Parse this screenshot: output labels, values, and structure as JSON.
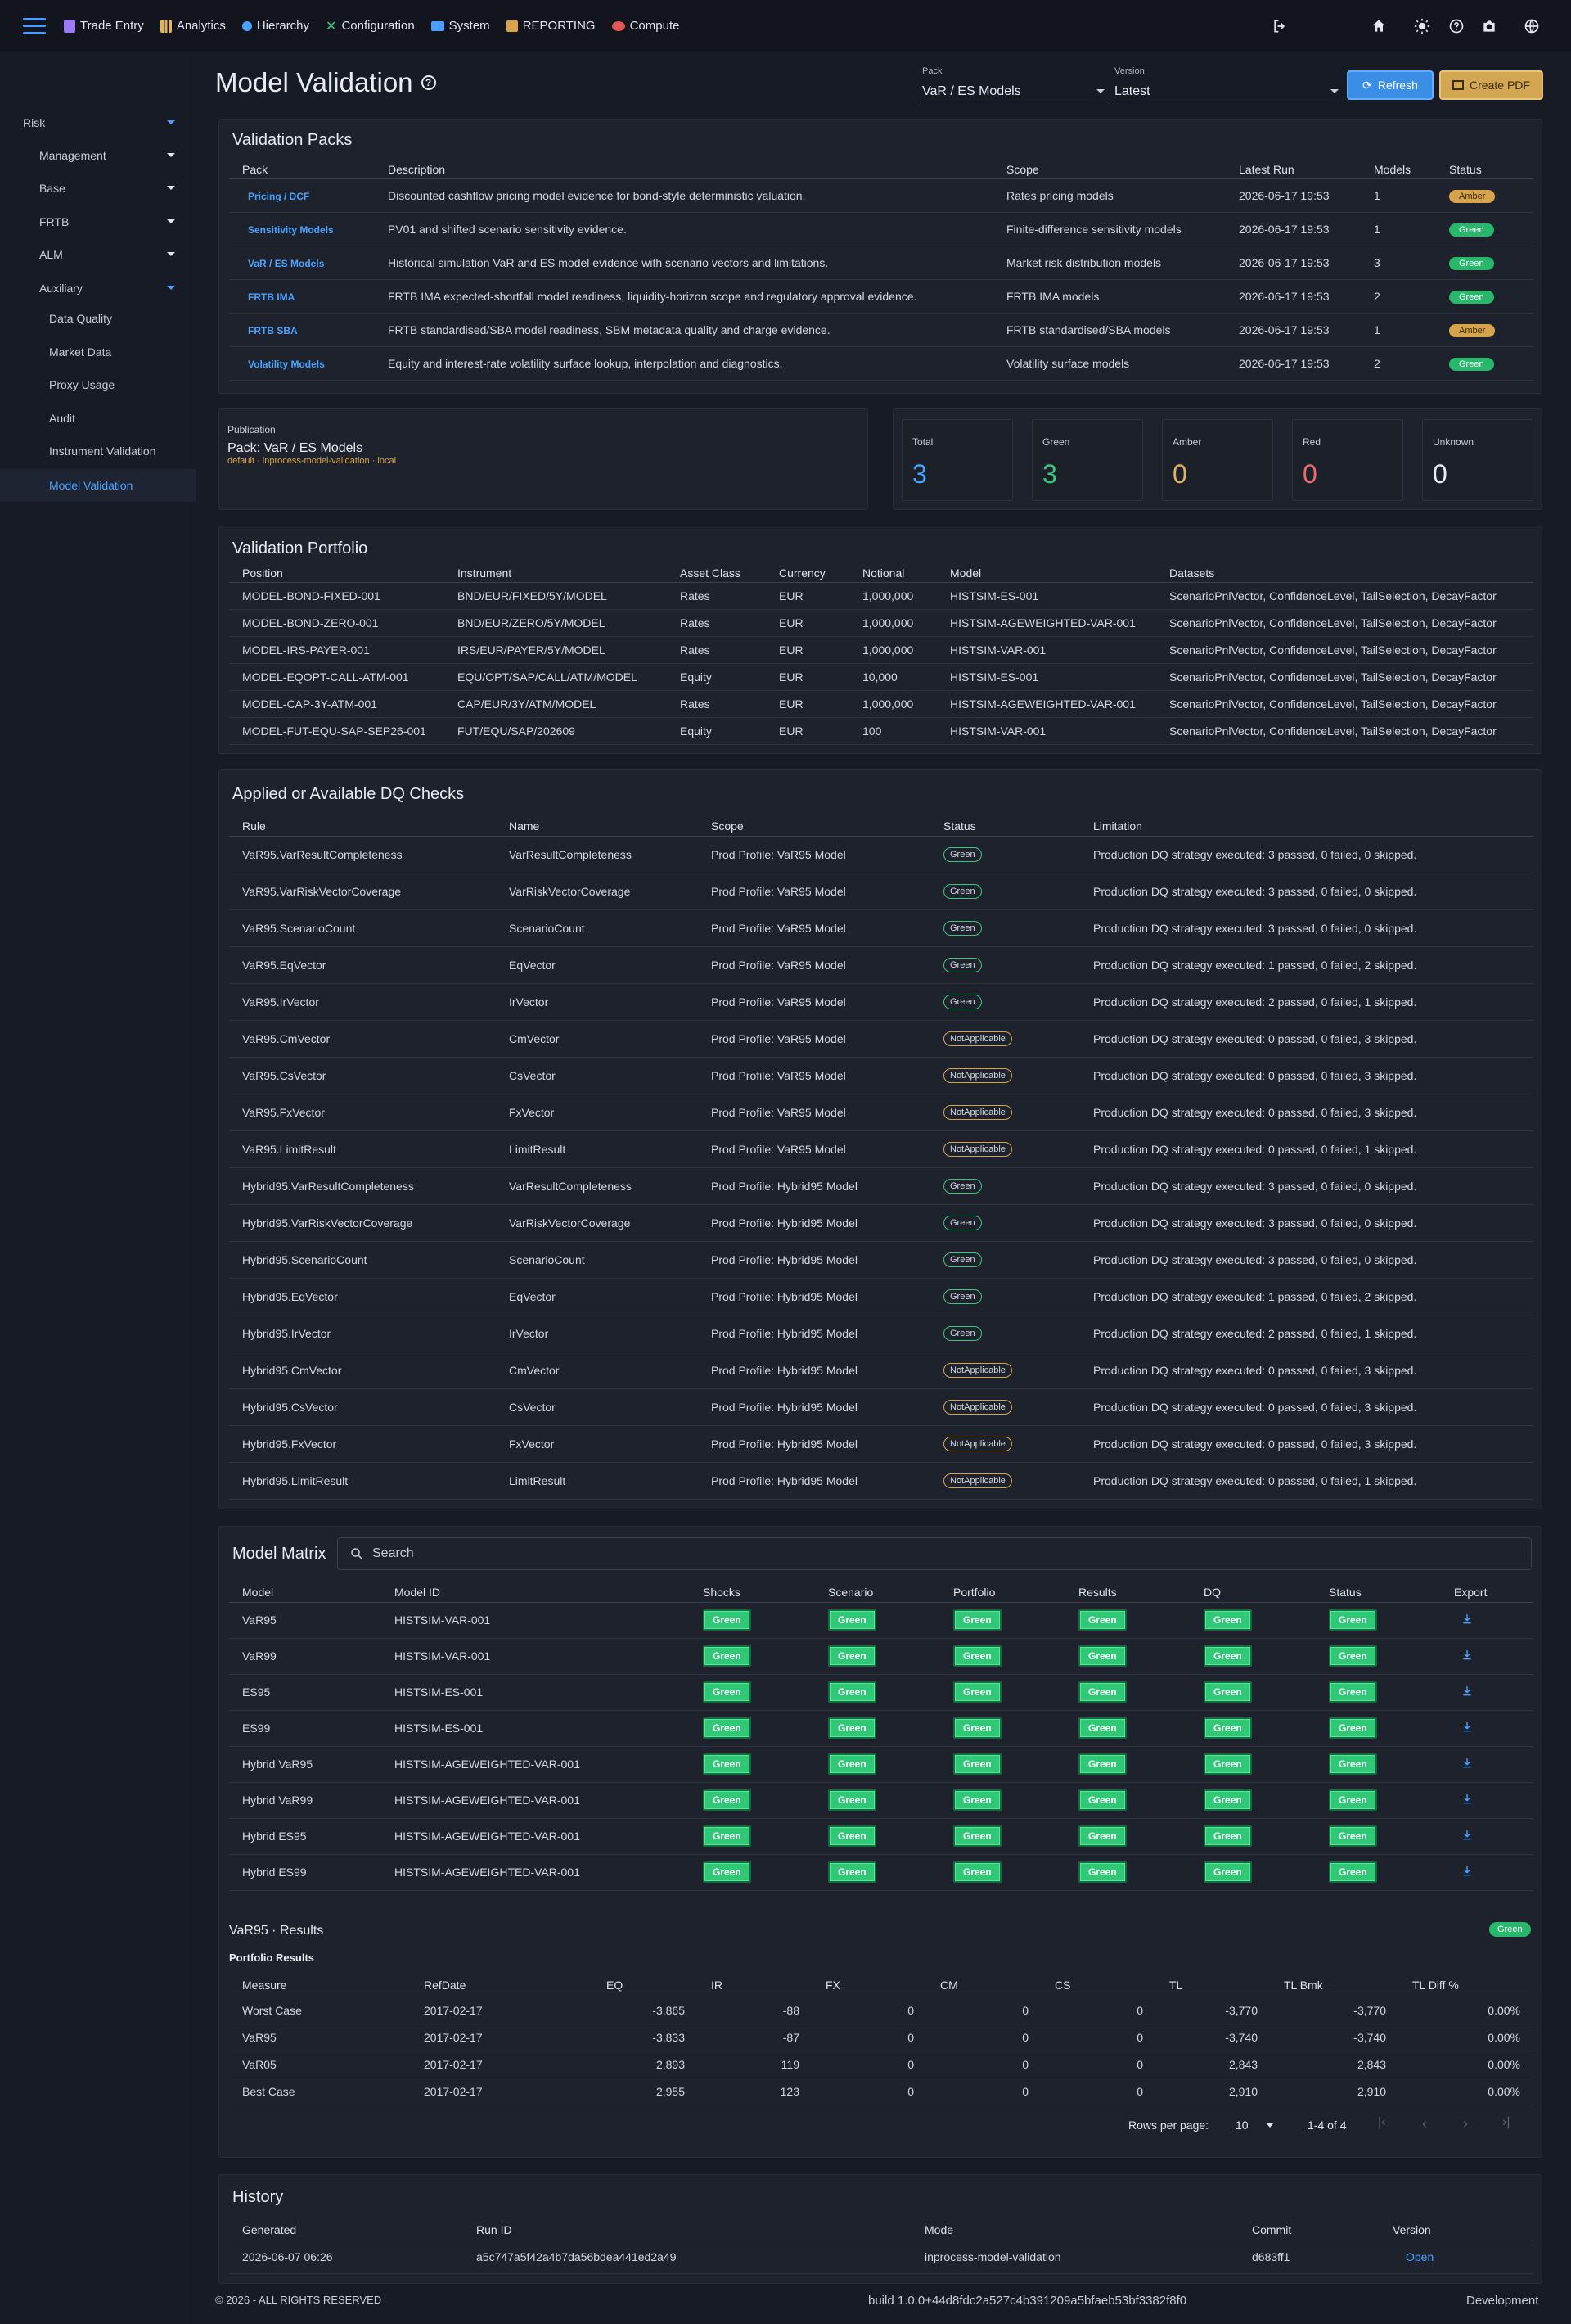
{
  "topnav": [
    "Trade Entry",
    "Analytics",
    "Hierarchy",
    "Configuration",
    "System",
    "REPORTING",
    "Compute"
  ],
  "sidebar": {
    "items": [
      "Risk",
      "Management",
      "Base",
      "FRTB",
      "ALM",
      "Auxiliary"
    ],
    "subitems": [
      "Data Quality",
      "Market Data",
      "Proxy Usage",
      "Audit",
      "Instrument Validation",
      "Model Validation"
    ]
  },
  "page": {
    "title": "Model Validation"
  },
  "controls": {
    "pack_label": "Pack",
    "pack_value": "VaR / ES Models",
    "version_label": "Version",
    "version_value": "Latest",
    "refresh": "Refresh",
    "create_pdf": "Create PDF"
  },
  "packs": {
    "title": "Validation Packs",
    "headers": [
      "Pack",
      "Description",
      "Scope",
      "Latest Run",
      "Models",
      "Status"
    ],
    "rows": [
      [
        "Pricing / DCF",
        "Discounted cashflow pricing model evidence for bond-style deterministic valuation.",
        "Rates pricing models",
        "2026-06-17 19:53",
        "1",
        "Amber"
      ],
      [
        "Sensitivity Models",
        "PV01 and shifted scenario sensitivity evidence.",
        "Finite-difference sensitivity models",
        "2026-06-17 19:53",
        "1",
        "Green"
      ],
      [
        "VaR / ES Models",
        "Historical simulation VaR and ES model evidence with scenario vectors and limitations.",
        "Market risk distribution models",
        "2026-06-17 19:53",
        "3",
        "Green"
      ],
      [
        "FRTB IMA",
        "FRTB IMA expected-shortfall model readiness, liquidity-horizon scope and regulatory approval evidence.",
        "FRTB IMA models",
        "2026-06-17 19:53",
        "2",
        "Green"
      ],
      [
        "FRTB SBA",
        "FRTB standardised/SBA model readiness, SBM metadata quality and charge evidence.",
        "FRTB standardised/SBA models",
        "2026-06-17 19:53",
        "1",
        "Amber"
      ],
      [
        "Volatility Models",
        "Equity and interest-rate volatility surface lookup, interpolation and diagnostics.",
        "Volatility surface models",
        "2026-06-17 19:53",
        "2",
        "Green"
      ]
    ]
  },
  "publication": {
    "label": "Publication",
    "pack": "Pack: VaR / ES Models",
    "meta": "default · inprocess-model-validation · local"
  },
  "stats": [
    {
      "label": "Total",
      "value": "3",
      "color": "#4aa3ff"
    },
    {
      "label": "Green",
      "value": "3",
      "color": "#3cc77c"
    },
    {
      "label": "Amber",
      "value": "0",
      "color": "#e0b259"
    },
    {
      "label": "Red",
      "value": "0",
      "color": "#f06a6a"
    },
    {
      "label": "Unknown",
      "value": "0",
      "color": "#e8ebf0"
    }
  ],
  "portfolio": {
    "title": "Validation Portfolio",
    "headers": [
      "Position",
      "Instrument",
      "Asset Class",
      "Currency",
      "Notional",
      "Model",
      "Datasets"
    ],
    "rows": [
      [
        "MODEL-BOND-FIXED-001",
        "BND/EUR/FIXED/5Y/MODEL",
        "Rates",
        "EUR",
        "1,000,000",
        "HISTSIM-ES-001",
        "ScenarioPnlVector, ConfidenceLevel, TailSelection, DecayFactor"
      ],
      [
        "MODEL-BOND-ZERO-001",
        "BND/EUR/ZERO/5Y/MODEL",
        "Rates",
        "EUR",
        "1,000,000",
        "HISTSIM-AGEWEIGHTED-VAR-001",
        "ScenarioPnlVector, ConfidenceLevel, TailSelection, DecayFactor"
      ],
      [
        "MODEL-IRS-PAYER-001",
        "IRS/EUR/PAYER/5Y/MODEL",
        "Rates",
        "EUR",
        "1,000,000",
        "HISTSIM-VAR-001",
        "ScenarioPnlVector, ConfidenceLevel, TailSelection, DecayFactor"
      ],
      [
        "MODEL-EQOPT-CALL-ATM-001",
        "EQU/OPT/SAP/CALL/ATM/MODEL",
        "Equity",
        "EUR",
        "10,000",
        "HISTSIM-ES-001",
        "ScenarioPnlVector, ConfidenceLevel, TailSelection, DecayFactor"
      ],
      [
        "MODEL-CAP-3Y-ATM-001",
        "CAP/EUR/3Y/ATM/MODEL",
        "Rates",
        "EUR",
        "1,000,000",
        "HISTSIM-AGEWEIGHTED-VAR-001",
        "ScenarioPnlVector, ConfidenceLevel, TailSelection, DecayFactor"
      ],
      [
        "MODEL-FUT-EQU-SAP-SEP26-001",
        "FUT/EQU/SAP/202609",
        "Equity",
        "EUR",
        "100",
        "HISTSIM-VAR-001",
        "ScenarioPnlVector, ConfidenceLevel, TailSelection, DecayFactor"
      ]
    ]
  },
  "dq": {
    "title": "Applied or Available DQ Checks",
    "headers": [
      "Rule",
      "Name",
      "Scope",
      "Status",
      "Limitation"
    ],
    "rows": [
      [
        "VaR95.VarResultCompleteness",
        "VarResultCompleteness",
        "Prod Profile: VaR95 Model",
        "Green",
        "Production DQ strategy executed: 3 passed, 0 failed, 0 skipped."
      ],
      [
        "VaR95.VarRiskVectorCoverage",
        "VarRiskVectorCoverage",
        "Prod Profile: VaR95 Model",
        "Green",
        "Production DQ strategy executed: 3 passed, 0 failed, 0 skipped."
      ],
      [
        "VaR95.ScenarioCount",
        "ScenarioCount",
        "Prod Profile: VaR95 Model",
        "Green",
        "Production DQ strategy executed: 3 passed, 0 failed, 0 skipped."
      ],
      [
        "VaR95.EqVector",
        "EqVector",
        "Prod Profile: VaR95 Model",
        "Green",
        "Production DQ strategy executed: 1 passed, 0 failed, 2 skipped."
      ],
      [
        "VaR95.IrVector",
        "IrVector",
        "Prod Profile: VaR95 Model",
        "Green",
        "Production DQ strategy executed: 2 passed, 0 failed, 1 skipped."
      ],
      [
        "VaR95.CmVector",
        "CmVector",
        "Prod Profile: VaR95 Model",
        "NotApplicable",
        "Production DQ strategy executed: 0 passed, 0 failed, 3 skipped."
      ],
      [
        "VaR95.CsVector",
        "CsVector",
        "Prod Profile: VaR95 Model",
        "NotApplicable",
        "Production DQ strategy executed: 0 passed, 0 failed, 3 skipped."
      ],
      [
        "VaR95.FxVector",
        "FxVector",
        "Prod Profile: VaR95 Model",
        "NotApplicable",
        "Production DQ strategy executed: 0 passed, 0 failed, 3 skipped."
      ],
      [
        "VaR95.LimitResult",
        "LimitResult",
        "Prod Profile: VaR95 Model",
        "NotApplicable",
        "Production DQ strategy executed: 0 passed, 0 failed, 1 skipped."
      ],
      [
        "Hybrid95.VarResultCompleteness",
        "VarResultCompleteness",
        "Prod Profile: Hybrid95 Model",
        "Green",
        "Production DQ strategy executed: 3 passed, 0 failed, 0 skipped."
      ],
      [
        "Hybrid95.VarRiskVectorCoverage",
        "VarRiskVectorCoverage",
        "Prod Profile: Hybrid95 Model",
        "Green",
        "Production DQ strategy executed: 3 passed, 0 failed, 0 skipped."
      ],
      [
        "Hybrid95.ScenarioCount",
        "ScenarioCount",
        "Prod Profile: Hybrid95 Model",
        "Green",
        "Production DQ strategy executed: 3 passed, 0 failed, 0 skipped."
      ],
      [
        "Hybrid95.EqVector",
        "EqVector",
        "Prod Profile: Hybrid95 Model",
        "Green",
        "Production DQ strategy executed: 1 passed, 0 failed, 2 skipped."
      ],
      [
        "Hybrid95.IrVector",
        "IrVector",
        "Prod Profile: Hybrid95 Model",
        "Green",
        "Production DQ strategy executed: 2 passed, 0 failed, 1 skipped."
      ],
      [
        "Hybrid95.CmVector",
        "CmVector",
        "Prod Profile: Hybrid95 Model",
        "NotApplicable",
        "Production DQ strategy executed: 0 passed, 0 failed, 3 skipped."
      ],
      [
        "Hybrid95.CsVector",
        "CsVector",
        "Prod Profile: Hybrid95 Model",
        "NotApplicable",
        "Production DQ strategy executed: 0 passed, 0 failed, 3 skipped."
      ],
      [
        "Hybrid95.FxVector",
        "FxVector",
        "Prod Profile: Hybrid95 Model",
        "NotApplicable",
        "Production DQ strategy executed: 0 passed, 0 failed, 3 skipped."
      ],
      [
        "Hybrid95.LimitResult",
        "LimitResult",
        "Prod Profile: Hybrid95 Model",
        "NotApplicable",
        "Production DQ strategy executed: 0 passed, 0 failed, 1 skipped."
      ]
    ]
  },
  "matrix": {
    "title": "Model Matrix",
    "search_placeholder": "Search",
    "headers": [
      "Model",
      "Model ID",
      "Shocks",
      "Scenario",
      "Portfolio",
      "Results",
      "DQ",
      "Status",
      "Export"
    ],
    "rows": [
      [
        "VaR95",
        "HISTSIM-VAR-001"
      ],
      [
        "VaR99",
        "HISTSIM-VAR-001"
      ],
      [
        "ES95",
        "HISTSIM-ES-001"
      ],
      [
        "ES99",
        "HISTSIM-ES-001"
      ],
      [
        "Hybrid VaR95",
        "HISTSIM-AGEWEIGHTED-VAR-001"
      ],
      [
        "Hybrid VaR99",
        "HISTSIM-AGEWEIGHTED-VAR-001"
      ],
      [
        "Hybrid ES95",
        "HISTSIM-AGEWEIGHTED-VAR-001"
      ],
      [
        "Hybrid ES99",
        "HISTSIM-AGEWEIGHTED-VAR-001"
      ]
    ],
    "cell_value": "Green"
  },
  "results": {
    "title": "VaR95 · Results",
    "status": "Green",
    "subtitle": "Portfolio Results",
    "headers": [
      "Measure",
      "RefDate",
      "EQ",
      "IR",
      "FX",
      "CM",
      "CS",
      "TL",
      "TL Bmk",
      "TL Diff %"
    ],
    "rows": [
      [
        "Worst Case",
        "2017-02-17",
        "-3,865",
        "-88",
        "0",
        "0",
        "0",
        "-3,770",
        "-3,770",
        "0.00%"
      ],
      [
        "VaR95",
        "2017-02-17",
        "-3,833",
        "-87",
        "0",
        "0",
        "0",
        "-3,740",
        "-3,740",
        "0.00%"
      ],
      [
        "VaR05",
        "2017-02-17",
        "2,893",
        "119",
        "0",
        "0",
        "0",
        "2,843",
        "2,843",
        "0.00%"
      ],
      [
        "Best Case",
        "2017-02-17",
        "2,955",
        "123",
        "0",
        "0",
        "0",
        "2,910",
        "2,910",
        "0.00%"
      ]
    ],
    "rows_per_page_label": "Rows per page:",
    "rows_per_page": "10",
    "range": "1-4 of 4"
  },
  "history": {
    "title": "History",
    "headers": [
      "Generated",
      "Run ID",
      "Mode",
      "Commit",
      "Version"
    ],
    "rows": [
      [
        "2026-06-07 06:26",
        "a5c747a5f42a4b7da56bdea441ed2a49",
        "inprocess-model-validation",
        "d683ff1",
        "Open"
      ]
    ]
  },
  "footer": {
    "copyright": "© 2026 - ALL RIGHTS RESERVED",
    "build": "build 1.0.0+44d8fdc2a527c4b391209a5bfaeb53bf3382f8f0",
    "env": "Development"
  }
}
